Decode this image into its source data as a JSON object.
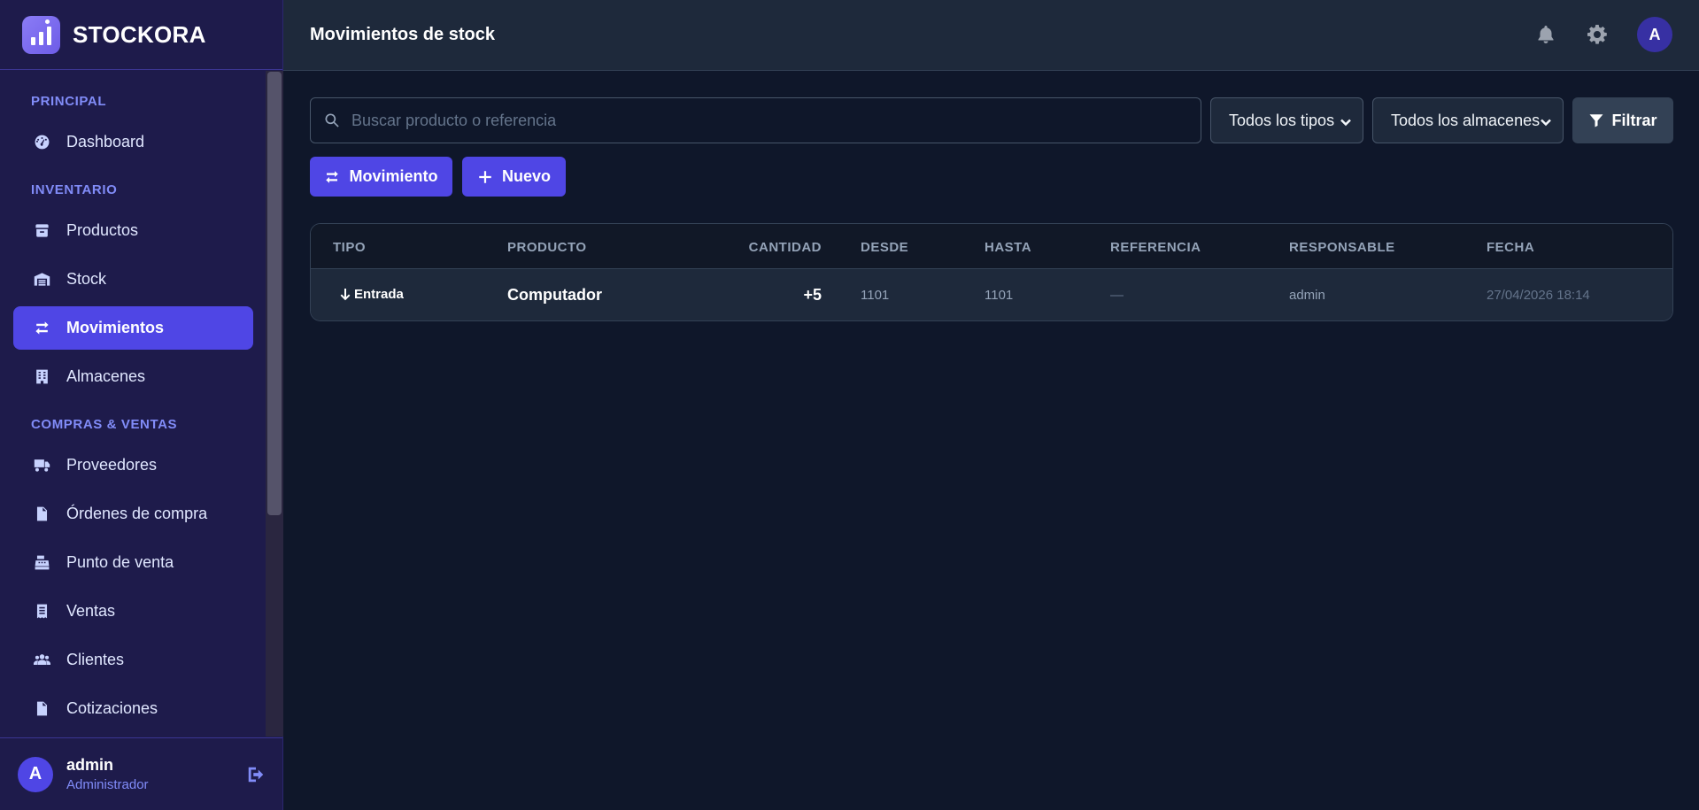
{
  "brand": {
    "name": "STOCKORA"
  },
  "sidebar": {
    "sections": [
      {
        "title": "PRINCIPAL",
        "items": [
          {
            "label": "Dashboard",
            "icon": "gauge-icon"
          }
        ]
      },
      {
        "title": "INVENTARIO",
        "items": [
          {
            "label": "Productos",
            "icon": "box-icon"
          },
          {
            "label": "Stock",
            "icon": "warehouse-icon"
          },
          {
            "label": "Movimientos",
            "icon": "arrows-exchange-icon",
            "active": true
          },
          {
            "label": "Almacenes",
            "icon": "building-icon"
          }
        ]
      },
      {
        "title": "COMPRAS & VENTAS",
        "items": [
          {
            "label": "Proveedores",
            "icon": "truck-icon"
          },
          {
            "label": "Órdenes de compra",
            "icon": "file-invoice-icon"
          },
          {
            "label": "Punto de venta",
            "icon": "cash-register-icon"
          },
          {
            "label": "Ventas",
            "icon": "receipt-icon"
          },
          {
            "label": "Clientes",
            "icon": "users-icon"
          },
          {
            "label": "Cotizaciones",
            "icon": "file-icon"
          }
        ]
      }
    ],
    "user": {
      "initial": "A",
      "name": "admin",
      "role": "Administrador"
    }
  },
  "topbar": {
    "title": "Movimientos de stock",
    "avatar_initial": "A"
  },
  "filters": {
    "search_placeholder": "Buscar producto o referencia",
    "type_select": "Todos los tipos",
    "warehouse_select": "Todos los almacenes",
    "filter_label": "Filtrar"
  },
  "actions": {
    "movement_label": "Movimiento",
    "new_label": "Nuevo"
  },
  "table": {
    "columns": [
      "TIPO",
      "PRODUCTO",
      "CANTIDAD",
      "DESDE",
      "HASTA",
      "REFERENCIA",
      "RESPONSABLE",
      "FECHA"
    ],
    "rows": [
      {
        "type": "Entrada",
        "product": "Computador",
        "quantity": "+5",
        "from": "1101",
        "to": "1101",
        "reference": "—",
        "responsible": "admin",
        "date": "27/04/2026 18:14"
      }
    ]
  },
  "colors": {
    "accent": "#4f46e5",
    "sidebar_bg": "#1e1b4b",
    "main_bg": "#0f172a",
    "topbar_bg": "#1e293b"
  }
}
